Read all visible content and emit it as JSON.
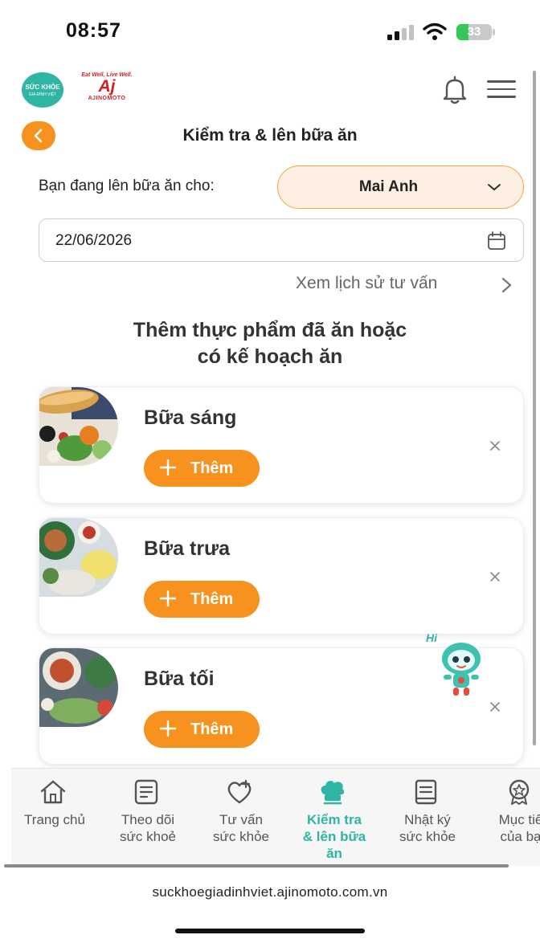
{
  "status_bar": {
    "time": "08:57",
    "battery": "33",
    "battery_level": 0.33
  },
  "header": {
    "brand_logo_line1": "SỨC KHỎE",
    "brand_logo_line2": "GIA ĐÌNH VIỆT",
    "partner_tagline": "Eat Well, Live Well.",
    "partner_mark": "Aj",
    "partner_name": "AJINOMOTO"
  },
  "page": {
    "title": "Kiểm tra & lên bữa ăn",
    "plan_for_label": "Bạn đang lên bữa ăn cho:",
    "selected_person": "Mai Anh",
    "date": "22/06/2026",
    "history_link": "Xem lịch sử tư vấn",
    "section_title_line1": "Thêm thực phẩm đã ăn hoặc",
    "section_title_line2": "có kế hoạch ăn"
  },
  "meals": [
    {
      "name": "Bữa sáng",
      "add_label": "Thêm",
      "image": "breakfast-photo"
    },
    {
      "name": "Bữa trưa",
      "add_label": "Thêm",
      "image": "lunch-photo"
    },
    {
      "name": "Bữa tối",
      "add_label": "Thêm",
      "image": "dinner-photo"
    }
  ],
  "mascot": {
    "greeting": "Hi"
  },
  "bottom_nav": [
    {
      "label_line1": "Trang chủ",
      "label_line2": "",
      "label_line3": "",
      "icon": "home-icon",
      "active": false
    },
    {
      "label_line1": "Theo dõi",
      "label_line2": "sức khoẻ",
      "label_line3": "",
      "icon": "health-tracker-icon",
      "active": false
    },
    {
      "label_line1": "Tư vấn",
      "label_line2": "sức khỏe",
      "label_line3": "",
      "icon": "heart-plus-icon",
      "active": false
    },
    {
      "label_line1": "Kiểm tra",
      "label_line2": "& lên bữa",
      "label_line3": "ăn",
      "icon": "chef-hat-icon",
      "active": true
    },
    {
      "label_line1": "Nhật ký",
      "label_line2": "sức khỏe",
      "label_line3": "",
      "icon": "journal-icon",
      "active": false
    },
    {
      "label_line1": "Mục tiê",
      "label_line2": "của bạ",
      "label_line3": "",
      "icon": "badge-icon",
      "active": false
    }
  ],
  "browser": {
    "url": "suckhoegiadinhviet.ajinomoto.com.vn"
  },
  "colors": {
    "accent": "#f7921e",
    "teal": "#2eb5a3",
    "select_bg": "#fdf0e2"
  }
}
